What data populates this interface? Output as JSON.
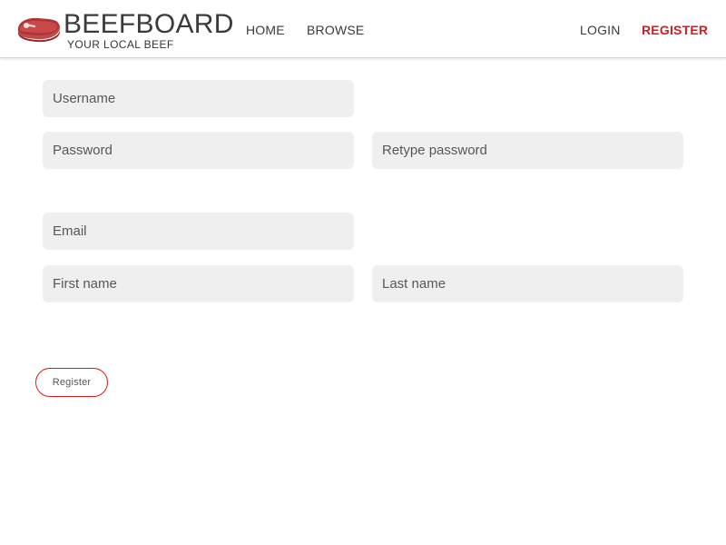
{
  "brand": {
    "name": "BEEFBOARD",
    "tagline": "YOUR LOCAL BEEF",
    "logo_icon": "steak-icon",
    "accent_color": "#d6191e"
  },
  "nav": {
    "home": "HOME",
    "browse": "BROWSE",
    "login": "LOGIN",
    "register": "REGISTER"
  },
  "form": {
    "username": {
      "placeholder": "Username",
      "value": ""
    },
    "password": {
      "placeholder": "Password",
      "value": ""
    },
    "retype_password": {
      "placeholder": "Retype password",
      "value": ""
    },
    "email": {
      "placeholder": "Email",
      "value": ""
    },
    "first_name": {
      "placeholder": "First name",
      "value": ""
    },
    "last_name": {
      "placeholder": "Last name",
      "value": ""
    },
    "submit_label": "Register"
  }
}
